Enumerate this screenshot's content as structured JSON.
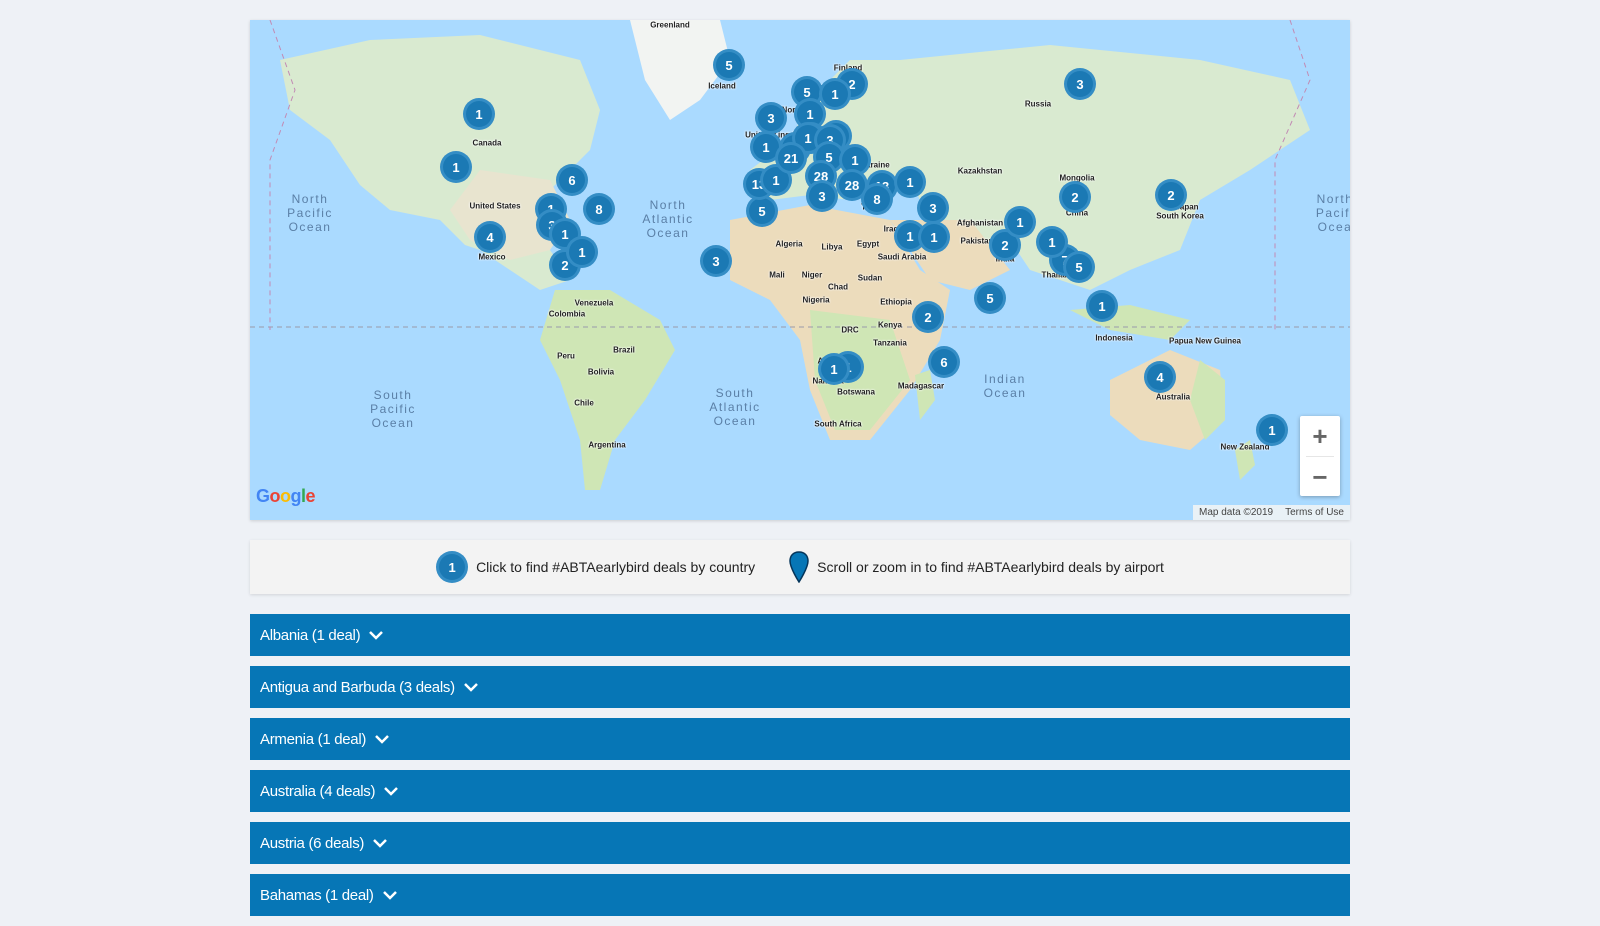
{
  "map": {
    "oceans": [
      {
        "lines": [
          "North",
          "Pacific",
          "Ocean"
        ]
      },
      {
        "lines": [
          "North",
          "Atlantic",
          "Ocean"
        ]
      },
      {
        "lines": [
          "South",
          "Pacific",
          "Ocean"
        ]
      },
      {
        "lines": [
          "South",
          "Atlantic",
          "Ocean"
        ]
      },
      {
        "lines": [
          "Indian",
          "Ocean"
        ]
      },
      {
        "lines": [
          "North",
          "Pacifi",
          "Ocea"
        ]
      }
    ],
    "places": [
      "Greenland",
      "Iceland",
      "Finland",
      "Sweden",
      "Norway",
      "Russia",
      "Canada",
      "United States",
      "Mexico",
      "Venezuela",
      "Colombia",
      "Peru",
      "Brazil",
      "Bolivia",
      "Chile",
      "Argentina",
      "Algeria",
      "Libya",
      "Egypt",
      "Mali",
      "Niger",
      "Chad",
      "Sudan",
      "Nigeria",
      "Ethiopia",
      "Kenya",
      "DRC",
      "Tanzania",
      "Angola",
      "Namibia",
      "Botswana",
      "South Africa",
      "Madagascar",
      "Kazakhstan",
      "Mongolia",
      "Ukraine",
      "Turkey",
      "Iraq",
      "Iran",
      "Afghanistan",
      "Pakistan",
      "Saudi Arabia",
      "India",
      "China",
      "South Korea",
      "Japan",
      "Thailand",
      "Indonesia",
      "Papua New Guinea",
      "Australia",
      "New Zealand",
      "United Kingdom",
      "France"
    ],
    "clusters": [
      5,
      2,
      5,
      1,
      3,
      1,
      1,
      3,
      1,
      6,
      8,
      1,
      3,
      1,
      4,
      2,
      2,
      2,
      1,
      1,
      3,
      1,
      3,
      5,
      2,
      13,
      1,
      21,
      5,
      1,
      28,
      28,
      3,
      13,
      8,
      1,
      3,
      1,
      1,
      2,
      1,
      2,
      7,
      5,
      1,
      1,
      2,
      1,
      5,
      6,
      4,
      1,
      1,
      3
    ],
    "google_logo": "Google",
    "attribution": [
      "Map data ©2019",
      "Terms of Use"
    ],
    "zoom_in": "+",
    "zoom_out": "−"
  },
  "legend": {
    "sample_count": "1",
    "country_text": "Click to find #ABTAearlybird deals by country",
    "airport_text": "Scroll or zoom in to find #ABTAearlybird deals by airport"
  },
  "accordion": [
    "Albania (1 deal)",
    "Antigua and Barbuda (3 deals)",
    "Armenia (1 deal)",
    "Australia (4 deals)",
    "Austria (6 deals)",
    "Bahamas (1 deal)"
  ],
  "colors": {
    "cluster": "#1b79b4",
    "accordion": "#0676b6",
    "water": "#aadaff",
    "land": "#cfe6b5"
  }
}
